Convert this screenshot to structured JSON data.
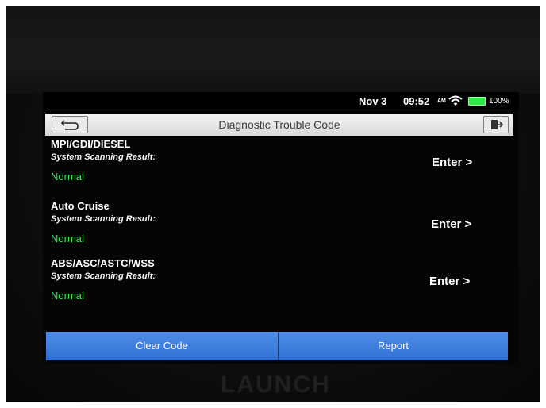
{
  "status_bar": {
    "date": "Nov 3",
    "time": "09:52",
    "ampm": "AM",
    "battery": "100%"
  },
  "header": {
    "title": "Diagnostic Trouble Code",
    "back_icon": "back-arrow-icon",
    "exit_icon": "exit-door-icon"
  },
  "systems": [
    {
      "name": "MPI/GDI/DIESEL",
      "label": "System Scanning Result:",
      "status": "Normal",
      "action": "Enter >"
    },
    {
      "name": "Auto Cruise",
      "label": "System Scanning Result:",
      "status": "Normal",
      "action": "Enter >"
    },
    {
      "name": "ABS/ASC/ASTC/WSS",
      "label": "System Scanning Result:",
      "status": "Normal",
      "action": "Enter >"
    }
  ],
  "footer": {
    "clear_code": "Clear Code",
    "report": "Report"
  },
  "device": {
    "brand": "LAUNCH"
  },
  "colors": {
    "status_ok": "#3ee05a",
    "button_blue": "#3a7bdc"
  }
}
